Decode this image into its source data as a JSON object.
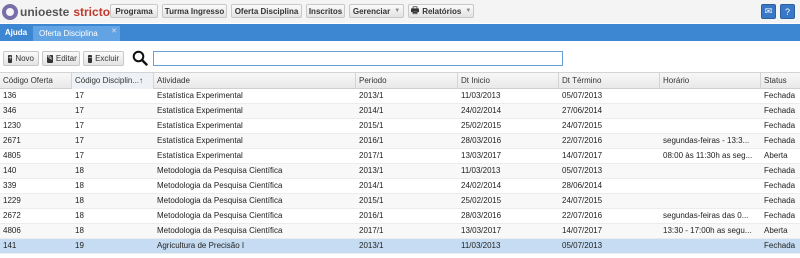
{
  "logo": {
    "text1": "unioeste",
    "text2": "stricto"
  },
  "menu": {
    "programa": "Programa",
    "turma": "Turma Ingresso",
    "oferta": "Oferta Disciplina",
    "inscritos": "Inscritos",
    "gerenciar": "Gerenciar",
    "relatorios": "Relatórios"
  },
  "tabs": {
    "ajuda": "Ajuda",
    "oferta": "Oferta Disciplina"
  },
  "toolbar": {
    "novo": "Novo",
    "editar": "Editar",
    "excluir": "Excluir"
  },
  "search": {
    "value": ""
  },
  "columns": [
    "Código Oferta",
    "Código Disciplin...",
    "Atividade",
    "Periodo",
    "Dt Inicio",
    "Dt Término",
    "Horário",
    "Status"
  ],
  "rows": [
    [
      "136",
      "17",
      "Estatística Experimental",
      "2013/1",
      "11/03/2013",
      "05/07/2013",
      "",
      "Fechada"
    ],
    [
      "346",
      "17",
      "Estatística Experimental",
      "2014/1",
      "24/02/2014",
      "27/06/2014",
      "",
      "Fechada"
    ],
    [
      "1230",
      "17",
      "Estatística Experimental",
      "2015/1",
      "25/02/2015",
      "24/07/2015",
      "",
      "Fechada"
    ],
    [
      "2671",
      "17",
      "Estatística Experimental",
      "2016/1",
      "28/03/2016",
      "22/07/2016",
      "segundas-feiras - 13:3...",
      "Fechada"
    ],
    [
      "4805",
      "17",
      "Estatística Experimental",
      "2017/1",
      "13/03/2017",
      "14/07/2017",
      "08:00 às 11:30h as seg...",
      "Aberta"
    ],
    [
      "140",
      "18",
      "Metodologia da Pesquisa Científica",
      "2013/1",
      "11/03/2013",
      "05/07/2013",
      "",
      "Fechada"
    ],
    [
      "339",
      "18",
      "Metodologia da Pesquisa Científica",
      "2014/1",
      "24/02/2014",
      "28/06/2014",
      "",
      "Fechada"
    ],
    [
      "1229",
      "18",
      "Metodologia da Pesquisa Científica",
      "2015/1",
      "25/02/2015",
      "24/07/2015",
      "",
      "Fechada"
    ],
    [
      "2672",
      "18",
      "Metodologia da Pesquisa Científica",
      "2016/1",
      "28/03/2016",
      "22/07/2016",
      "segundas-feiras das 0...",
      "Fechada"
    ],
    [
      "4806",
      "18",
      "Metodologia da Pesquisa Científica",
      "2017/1",
      "13/03/2017",
      "14/07/2017",
      "13:30 - 17:00h as segu...",
      "Aberta"
    ],
    [
      "141",
      "19",
      "Agricultura de Precisão I",
      "2013/1",
      "11/03/2013",
      "05/07/2013",
      "",
      "Fechada"
    ]
  ],
  "selected_row": 10,
  "icons": {
    "mail": "mail-icon",
    "help": "help-icon",
    "search": "search-icon",
    "print": "printer-icon"
  },
  "colors": {
    "tabbar": "#3d86d2",
    "active_tab": "#62a3e4",
    "selected_row": "#c5dcf2",
    "brand_red": "#c0392b"
  }
}
